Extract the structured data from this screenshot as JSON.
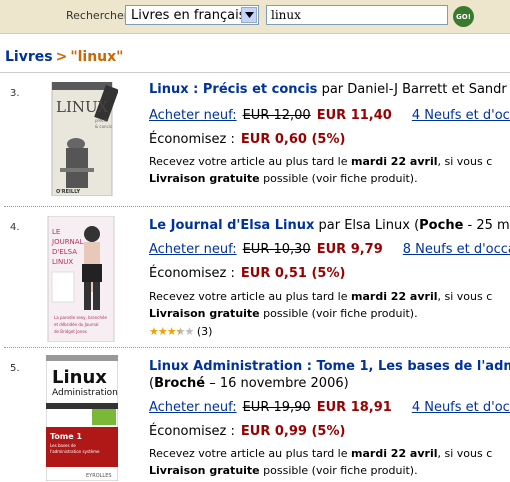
{
  "search": {
    "label": "Rechercher",
    "category": "Livres en français",
    "query": "linux",
    "go_label": "GO!"
  },
  "breadcrumb": {
    "root": "Livres",
    "separator": ">",
    "current": "\"linux\""
  },
  "results": [
    {
      "num": "3.",
      "title": "Linux : Précis et concis",
      "byline": "par Daniel-J Barrett et Sandr",
      "buy_label": "Acheter neuf:",
      "old_price": "EUR 12,00",
      "new_price": "EUR 11,40",
      "offers": "4 Neufs et d'occ",
      "save_label": "Économisez :",
      "save_amount": "EUR 0,60 (5%)",
      "delivery_pre": "Recevez votre article au plus tard le",
      "delivery_date": "mardi 22 avril",
      "delivery_post": ", si vous c",
      "free_label": "Livraison gratuite",
      "free_post": "possible (voir fiche produit).",
      "cover_text": [
        "LINUX"
      ]
    },
    {
      "num": "4.",
      "title": "Le Journal d'Elsa Linux",
      "byline": "par Elsa Linux",
      "format": "Poche",
      "byline_post": " - 25 m",
      "buy_label": "Acheter neuf:",
      "old_price": "EUR 10,30",
      "new_price": "EUR 9,79",
      "offers": "8 Neufs et d'occa",
      "save_label": "Économisez :",
      "save_amount": "EUR 0,51 (5%)",
      "delivery_pre": "Recevez votre article au plus tard le",
      "delivery_date": "mardi 22 avril",
      "delivery_post": ", si vous c",
      "free_label": "Livraison gratuite",
      "free_post": "possible (voir fiche produit).",
      "rating": 3.5,
      "rating_count": "(3)",
      "cover_text": [
        "LE",
        "JOURNAL",
        "D'ELSA",
        "LINUX"
      ]
    },
    {
      "num": "5.",
      "title": "Linux Administration : Tome 1, Les bases de l'adm",
      "format": "Broché",
      "format_date": " – 16 novembre 2006)",
      "buy_label": "Acheter neuf:",
      "old_price": "EUR 19,90",
      "new_price": "EUR 18,91",
      "offers": "4 Neufs et d'occ",
      "save_label": "Économisez :",
      "save_amount": "EUR 0,99 (5%)",
      "delivery_pre": "Recevez votre article au plus tard le",
      "delivery_date": "mardi 22 avril",
      "delivery_post": ", si vous c",
      "free_label": "Livraison gratuite",
      "free_post": "possible (voir fiche produit).",
      "cover_text": [
        "Linux",
        "Administration",
        "Tome 1"
      ]
    }
  ],
  "colors": {
    "link": "#003399",
    "price": "#990000",
    "breadcrumb_current": "#cc6600",
    "search_bar_bg": "#ede5cc",
    "go_button": "#3a7a2e"
  }
}
